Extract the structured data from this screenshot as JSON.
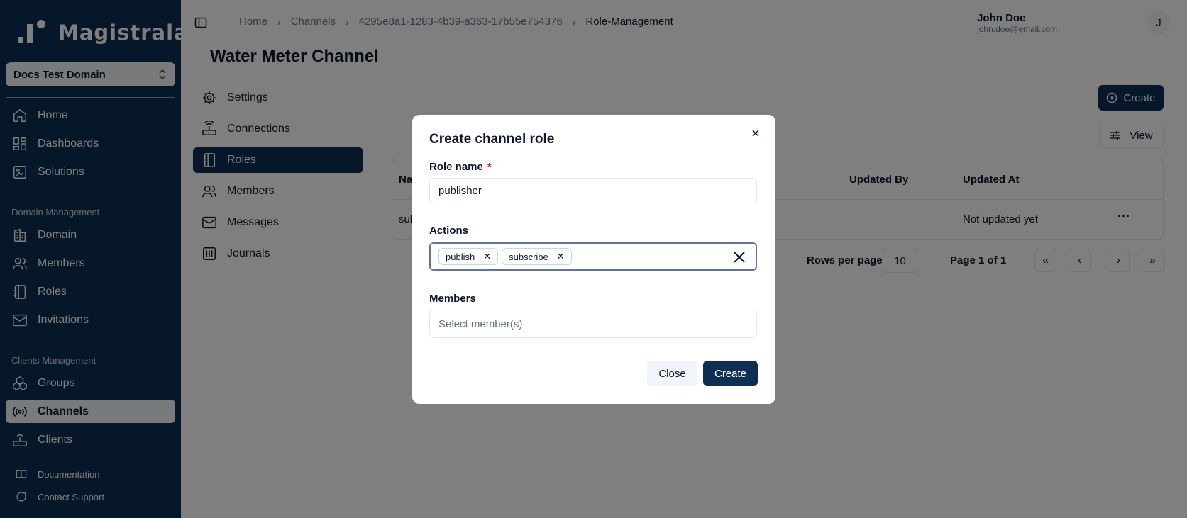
{
  "app": {
    "name": "Magistrala",
    "domain": "Docs Test Domain"
  },
  "sidebar": {
    "top_items": [
      {
        "label": "Home",
        "icon": "home-icon"
      },
      {
        "label": "Dashboards",
        "icon": "dashboard-icon"
      },
      {
        "label": "Solutions",
        "icon": "solutions-icon"
      }
    ],
    "domain_group": {
      "label": "Domain Management",
      "items": [
        {
          "label": "Domain",
          "icon": "building-icon"
        },
        {
          "label": "Members",
          "icon": "users-icon"
        },
        {
          "label": "Roles",
          "icon": "notebook-icon"
        },
        {
          "label": "Invitations",
          "icon": "mail-icon"
        }
      ]
    },
    "clients_group": {
      "label": "Clients Management",
      "items": [
        {
          "label": "Groups",
          "icon": "groups-icon"
        },
        {
          "label": "Channels",
          "icon": "radio-icon",
          "active": true
        },
        {
          "label": "Clients",
          "icon": "router-icon"
        }
      ]
    },
    "footer": [
      {
        "label": "Documentation",
        "icon": "book-icon"
      },
      {
        "label": "Contact Support",
        "icon": "chat-icon"
      }
    ]
  },
  "header": {
    "breadcrumb": [
      "Home",
      "Channels",
      "4295e8a1-1283-4b39-a363-17b55e754376",
      "Role-Management"
    ],
    "user_name": "John Doe",
    "user_email": "john.doe@email.com",
    "avatar_initial": "J"
  },
  "page": {
    "title": "Water Meter Channel"
  },
  "subnav": [
    {
      "label": "Settings",
      "icon": "settings-icon"
    },
    {
      "label": "Connections",
      "icon": "router-icon"
    },
    {
      "label": "Roles",
      "icon": "notebook-icon",
      "active": true
    },
    {
      "label": "Members",
      "icon": "users-icon"
    },
    {
      "label": "Messages",
      "icon": "mail-icon"
    },
    {
      "label": "Journals",
      "icon": "journal-icon"
    }
  ],
  "toolbar": {
    "create_label": "Create",
    "view_label": "View"
  },
  "table": {
    "headers": [
      "Na",
      "Updated By",
      "Updated At"
    ],
    "rows": [
      {
        "name": "sub",
        "updated_by": "",
        "updated_at": "Not updated yet"
      }
    ]
  },
  "pagination": {
    "rows_label": "Rows per page",
    "rows_value": "10",
    "page_label": "Page 1 of 1"
  },
  "dialog": {
    "title": "Create channel role",
    "role_name_label": "Role name",
    "required_mark": "*",
    "role_name_value": "publisher",
    "actions_label": "Actions",
    "actions": [
      "publish",
      "subscribe"
    ],
    "members_label": "Members",
    "members_placeholder": "Select member(s)",
    "close_label": "Close",
    "create_label": "Create"
  },
  "colors": {
    "brand": "#0d2f54",
    "surface": "#f1f5f9",
    "required": "#dc2626"
  }
}
